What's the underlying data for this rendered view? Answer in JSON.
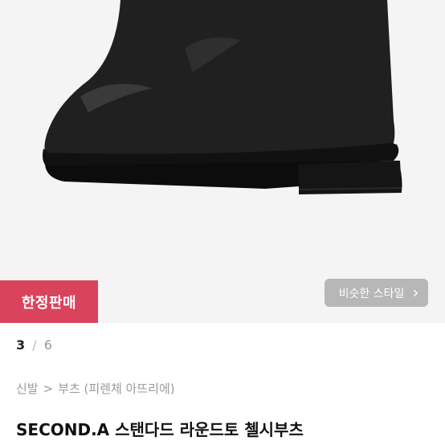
{
  "hero": {
    "image_alt": "black chelsea boot"
  },
  "badge": {
    "label": "한정판매"
  },
  "similar_button": {
    "label": "비슷한 스타일",
    "icon": "chevron-right-icon"
  },
  "pager": {
    "current": "3",
    "separator": "/",
    "total": "6"
  },
  "breadcrumb": {
    "root": "신발",
    "separator": ">",
    "current": "부츠 (피렌체 아뜨리에)"
  },
  "product": {
    "title": "SECOND.A 스탠다드 라운드토 첼시부츠"
  },
  "colors": {
    "badge": "#d9435b",
    "button": "#b7b7b7"
  }
}
